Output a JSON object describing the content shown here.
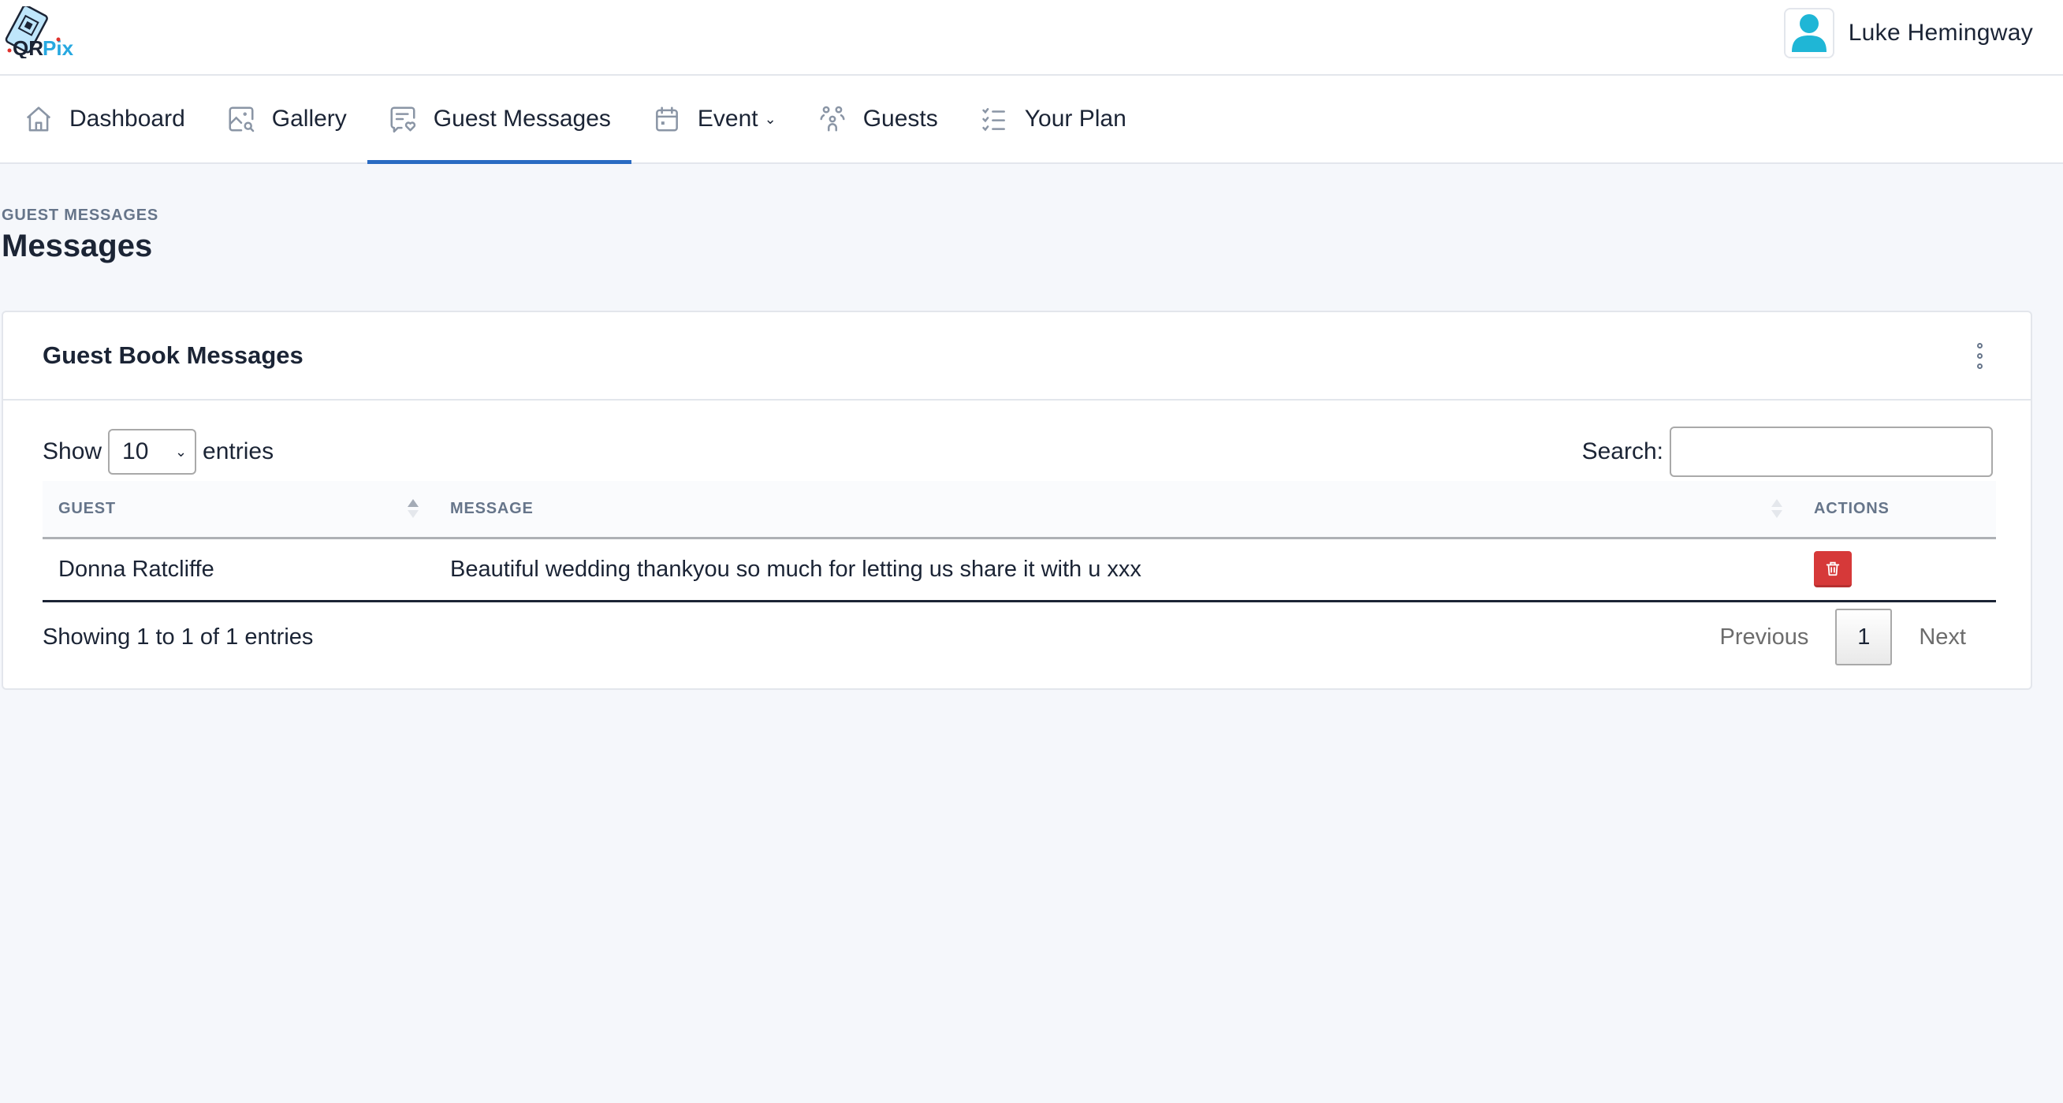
{
  "app": {
    "logo_text": "QRPix"
  },
  "user": {
    "name": "Luke Hemingway",
    "avatar_icon": "user-icon"
  },
  "nav": {
    "items": [
      {
        "label": "Dashboard",
        "icon": "home-icon",
        "active": false
      },
      {
        "label": "Gallery",
        "icon": "gallery-search-icon",
        "active": false
      },
      {
        "label": "Guest Messages",
        "icon": "message-heart-icon",
        "active": true
      },
      {
        "label": "Event",
        "icon": "calendar-icon",
        "active": false,
        "has_dropdown": true
      },
      {
        "label": "Guests",
        "icon": "users-icon",
        "active": false
      },
      {
        "label": "Your Plan",
        "icon": "checklist-icon",
        "active": false
      }
    ],
    "accent_color": "#2a6bc2"
  },
  "page": {
    "pretitle": "GUEST MESSAGES",
    "title": "Messages"
  },
  "card": {
    "title": "Guest Book Messages",
    "menu_icon": "kebab-menu-icon",
    "length": {
      "prefix": "Show",
      "value": "10",
      "suffix": "entries"
    },
    "search": {
      "label": "Search:",
      "value": "",
      "placeholder": ""
    },
    "table": {
      "columns": [
        {
          "label": "GUEST",
          "sort": "ascending"
        },
        {
          "label": "MESSAGE",
          "sort": "none"
        },
        {
          "label": "ACTIONS",
          "sort": null
        }
      ],
      "rows": [
        {
          "guest": "Donna Ratcliffe",
          "message": "Beautiful wedding thankyou so much for letting us share it with u xxx",
          "actions": [
            {
              "icon": "trash-icon",
              "color": "#d63939"
            }
          ]
        }
      ]
    },
    "info": "Showing 1 to 1 of 1 entries",
    "pagination": {
      "previous": "Previous",
      "current_page": "1",
      "next": "Next"
    }
  }
}
